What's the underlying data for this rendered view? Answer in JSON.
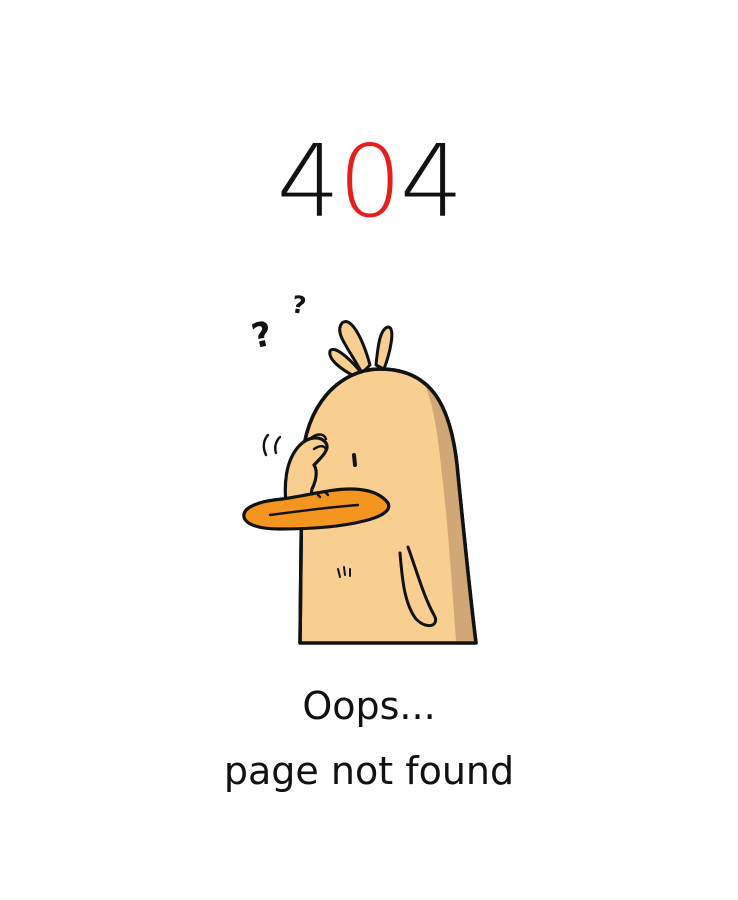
{
  "error": {
    "digit_1": "4",
    "digit_2": "0",
    "digit_3": "4",
    "accent_color": "#e4201d"
  },
  "illustration": {
    "subject": "confused duck scratching head",
    "question_marks": [
      "?",
      "?"
    ]
  },
  "message": {
    "line_1": "Oops...",
    "line_2": "page not found"
  },
  "colors": {
    "text": "#111111",
    "duck_body": "#f9cf91",
    "duck_shadow": "#c9a070",
    "beak": "#f4951f"
  }
}
